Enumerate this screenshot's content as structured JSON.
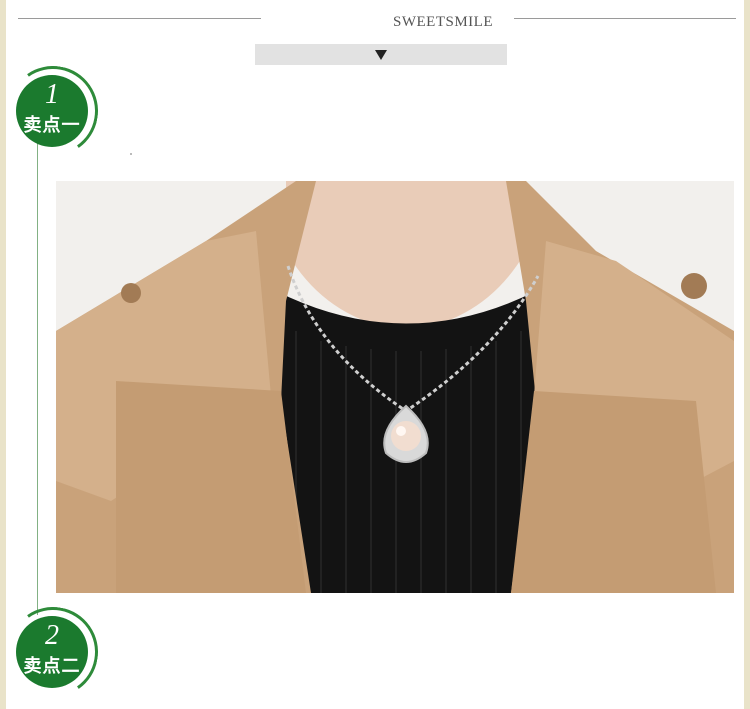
{
  "header": {
    "brand": "SWEETSMILE",
    "arrow_icon": "triangle-down-icon"
  },
  "points": [
    {
      "number": "1",
      "label": "卖点一"
    },
    {
      "number": "2",
      "label": "卖点二"
    }
  ],
  "colors": {
    "badge_green": "#1b7a2e",
    "coat": "#c9a27a",
    "sweater": "#131313",
    "pearl": "#f1ddd0"
  },
  "photo": {
    "subject": "pearl-pendant-necklace-photo"
  }
}
